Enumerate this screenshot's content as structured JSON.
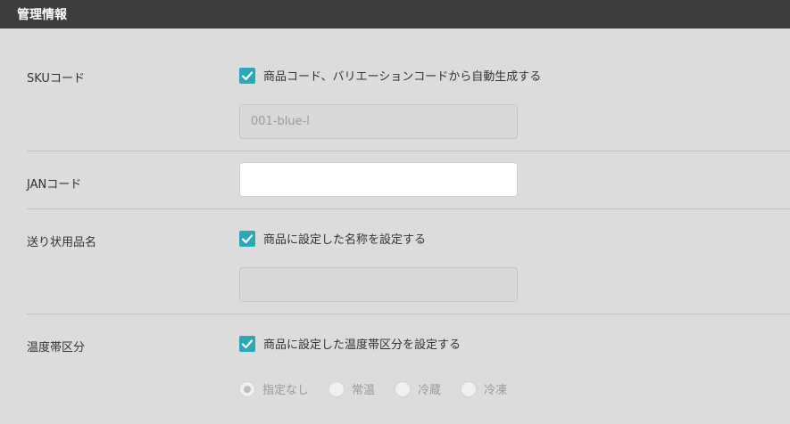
{
  "header": {
    "title": "管理情報"
  },
  "sku": {
    "label": "SKUコード",
    "checkbox_label": "商品コード、バリエーションコードから自動生成する",
    "checked": true,
    "input_value": "001-blue-l"
  },
  "jan": {
    "label": "JANコード",
    "input_value": ""
  },
  "shipping_name": {
    "label": "送り状用品名",
    "checkbox_label": "商品に設定した名称を設定する",
    "checked": true,
    "input_value": ""
  },
  "temperature": {
    "label": "温度帯区分",
    "checkbox_label": "商品に設定した温度帯区分を設定する",
    "checked": true,
    "options": [
      "指定なし",
      "常温",
      "冷蔵",
      "冷凍"
    ],
    "selected": "指定なし"
  },
  "colors": {
    "accent": "#2aa8b8",
    "header_bg": "#3d3d3d",
    "page_bg": "#dcdcdc"
  }
}
